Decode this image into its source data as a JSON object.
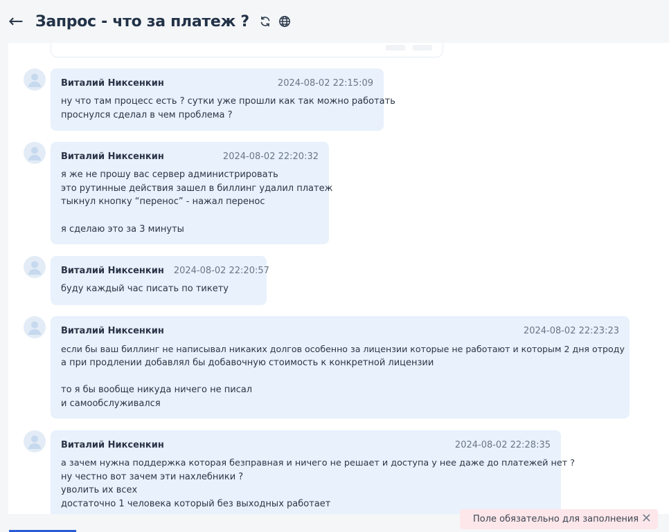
{
  "header": {
    "back_icon": "arrow-left-icon",
    "title": "Запрос - что за платеж ?",
    "icons": [
      "refresh-icon",
      "globe-icon"
    ]
  },
  "messages": [
    {
      "author": "Виталий Никсенкин",
      "time": "2024-08-02 22:15:09",
      "lines": [
        "ну что там процесс есть ? сутки уже прошли как так можно работать",
        "проснулся сделал в чем проблема ?"
      ]
    },
    {
      "author": "Виталий Никсенкин",
      "time": "2024-08-02 22:20:32",
      "lines": [
        "я же не прошу вас сервер администрировать",
        "это рутинные действия зашел в биллинг удалил платеж",
        "тыкнул кнопку “перенос” - нажал перенос",
        "",
        "я сделаю это за 3 минуты"
      ]
    },
    {
      "author": "Виталий Никсенкин",
      "time": "2024-08-02 22:20:57",
      "lines": [
        "буду каждый час писать по тикету"
      ]
    },
    {
      "author": "Виталий Никсенкин",
      "time": "2024-08-02 22:23:23",
      "lines": [
        "если бы ваш биллинг не написывал никаких долгов особенно за лицензии которые не работают и которым 2 дня отроду",
        "а при продлении добавлял бы добавочную стоимость к конкретной лицензии",
        "",
        "то я бы вообще никуда ничего не писал",
        "и самообслуживался"
      ]
    },
    {
      "author": "Виталий Никсенкин",
      "time": "2024-08-02 22:28:35",
      "lines": [
        "а зачем нужна поддержка которая безправная и ничего не решает и доступа у нее даже до платежей нет ?",
        "ну честно вот зачем эти нахлебники ?",
        "уволить их всех",
        "достаточно 1 человека который без выходных работает"
      ]
    }
  ],
  "toast": {
    "text": "Поле обязательно для заполнения",
    "close_icon": "close-icon"
  },
  "colors": {
    "bubble": "#e8f1fc",
    "background": "#f5f6f8",
    "toast": "#fde7ea",
    "accent": "#2a5bd7"
  }
}
